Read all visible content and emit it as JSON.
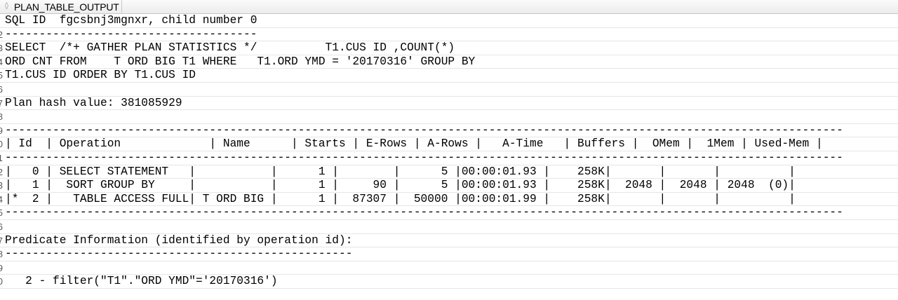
{
  "column": {
    "grip_icon": "drag-handle-icon",
    "grip_glyph": "◊",
    "header": "PLAN_TABLE_OUTPUT"
  },
  "rows": [
    {
      "num": "",
      "text": "SQL ID  fgcsbnj3mgnxr, child number 0"
    },
    {
      "num": "2",
      "text": "-------------------------------------"
    },
    {
      "num": "3",
      "text": "SELECT  /*+ GATHER PLAN STATISTICS */          T1.CUS ID ,COUNT(*)"
    },
    {
      "num": "4",
      "text": "ORD CNT FROM    T ORD BIG T1 WHERE   T1.ORD YMD = '20170316' GROUP BY"
    },
    {
      "num": "5",
      "text": "T1.CUS ID ORDER BY T1.CUS ID"
    },
    {
      "num": "6",
      "text": ""
    },
    {
      "num": "7",
      "text": "Plan hash value: 381085929"
    },
    {
      "num": "8",
      "text": ""
    },
    {
      "num": "9",
      "text": "---------------------------------------------------------------------------------------------------------------------------"
    },
    {
      "num": "0",
      "text": "| Id  | Operation             | Name      | Starts | E-Rows | A-Rows |   A-Time   | Buffers |  OMem |  1Mem | Used-Mem |"
    },
    {
      "num": "1",
      "text": "---------------------------------------------------------------------------------------------------------------------------"
    },
    {
      "num": "2",
      "text": "|   0 | SELECT STATEMENT   |           |      1 |        |      5 |00:00:01.93 |    258K|       |       |          |"
    },
    {
      "num": "3",
      "text": "|   1 |  SORT GROUP BY     |           |      1 |     90 |      5 |00:00:01.93 |    258K|  2048 |  2048 | 2048  (0)|"
    },
    {
      "num": "4",
      "text": "|*  2 |   TABLE ACCESS FULL| T ORD BIG |      1 |  87307 |  50000 |00:00:01.99 |    258K|       |       |          |"
    },
    {
      "num": "5",
      "text": "---------------------------------------------------------------------------------------------------------------------------"
    },
    {
      "num": "6",
      "text": ""
    },
    {
      "num": "7",
      "text": "Predicate Information (identified by operation id):"
    },
    {
      "num": "8",
      "text": "---------------------------------------------------"
    },
    {
      "num": "9",
      "text": ""
    },
    {
      "num": "0",
      "text": "   2 - filter(\"T1\".\"ORD YMD\"='20170316')"
    },
    {
      "num": "",
      "text": ""
    }
  ]
}
